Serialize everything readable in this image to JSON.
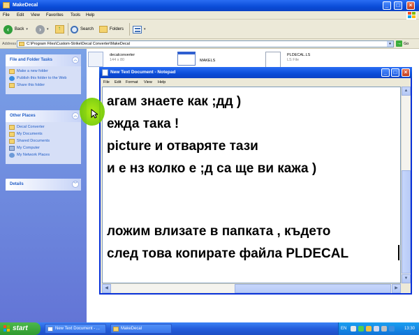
{
  "explorer": {
    "title": "MakeDecal",
    "menu": [
      "File",
      "Edit",
      "View",
      "Favorites",
      "Tools",
      "Help"
    ],
    "toolbar": {
      "back": "Back",
      "search": "Search",
      "folders": "Folders"
    },
    "address": {
      "label": "Address",
      "path": "C:\\Program Files\\Custom-Strike\\Decal Converter\\MakeDecal",
      "go": "Go"
    }
  },
  "taskpane": {
    "file_tasks": {
      "title": "File and Folder Tasks",
      "items": [
        "Make a new folder",
        "Publish this folder to the Web",
        "Share this folder"
      ]
    },
    "other_places": {
      "title": "Other Places",
      "items": [
        "Decal Converter",
        "My Documents",
        "Shared Documents",
        "My Computer",
        "My Network Places"
      ]
    },
    "details": {
      "title": "Details"
    }
  },
  "files": [
    {
      "name": "decalconverter",
      "sub": "144 x 80"
    },
    {
      "name": "MAKELS",
      "sub": ""
    },
    {
      "name": "PLDECAL.LS",
      "sub": "LS File"
    }
  ],
  "notepad": {
    "title": "New Text Document - Notepad",
    "menu": [
      "File",
      "Edit",
      "Format",
      "View",
      "Help"
    ],
    "lines": [
      "агам знаете как ;дд )",
      "ежда така !",
      "picture и отваряте тази",
      "и е нз колко е ;д са ще ви кажа )",
      "",
      "ложим влизате в папката , където",
      "след това копирате файла PLDECAL"
    ]
  },
  "taskbar": {
    "start": "start",
    "buttons": [
      "New Text Document - ...",
      "MakeDecal"
    ],
    "lang": "EN",
    "clock": "13:30"
  },
  "colors": {
    "title_blue": "#0a4cd8",
    "pane_blue": "#6375d6",
    "highlight": "#7ed000"
  }
}
